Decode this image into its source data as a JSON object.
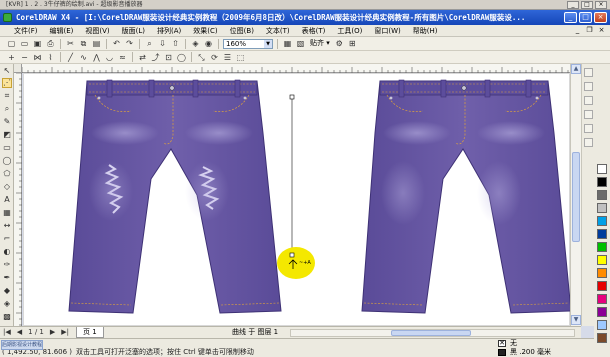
{
  "player": {
    "title": "[KVR] 1 . 2 . 3牛仔裤的绘制.avi - 超级影音播放器",
    "buttons": [
      "_",
      "□",
      "×"
    ]
  },
  "window": {
    "title": "CorelDRAW X4 - [I:\\CorelDRAW服装设计经典实例教程（2009年6月8日改）\\CorelDRAW服装设计经典实例教程-所有图片\\CorelDRAW服装设...",
    "minimize": "_",
    "maximize": "□",
    "close": "×"
  },
  "menu": {
    "items": [
      "文件(F)",
      "编辑(E)",
      "视图(V)",
      "版面(L)",
      "排列(A)",
      "效果(C)",
      "位图(B)",
      "文本(T)",
      "表格(T)",
      "工具(O)",
      "窗口(W)",
      "帮助(H)"
    ]
  },
  "toolbar": {
    "zoom": "160%",
    "snap_label": "贴齐 ▾"
  },
  "navigator": {
    "first": "|◀",
    "prev": "◀",
    "page_count": "1 / 1",
    "next": "▶",
    "last": "▶|",
    "page_tab": "页 1",
    "selection_info": "曲线 于 图层 1"
  },
  "status": {
    "coords": "( 1,492.50, 81.606 )",
    "tool_hint": "双击工具可打开泛塞的选项；按住 Ctrl 键单击可限制移动",
    "fill_label": "无",
    "stroke_label": "黑 .200 毫米",
    "watermark": "后期影视设计教程"
  },
  "colors": {
    "denim": "#6a5aa6",
    "denim_dark": "#4b3c86",
    "stitch": "#e0a33a",
    "highlight": "#f4e800",
    "titlebar": "#2f66d8"
  },
  "palette": [
    "#ffffff",
    "#000000",
    "#6b6b6b",
    "#c0c0c0",
    "#00a0e6",
    "#003c9c",
    "#00c000",
    "#ffff00",
    "#ff8c00",
    "#e60000",
    "#e6007e",
    "#8b0096",
    "#9ec9ff",
    "#7b4a2a"
  ]
}
